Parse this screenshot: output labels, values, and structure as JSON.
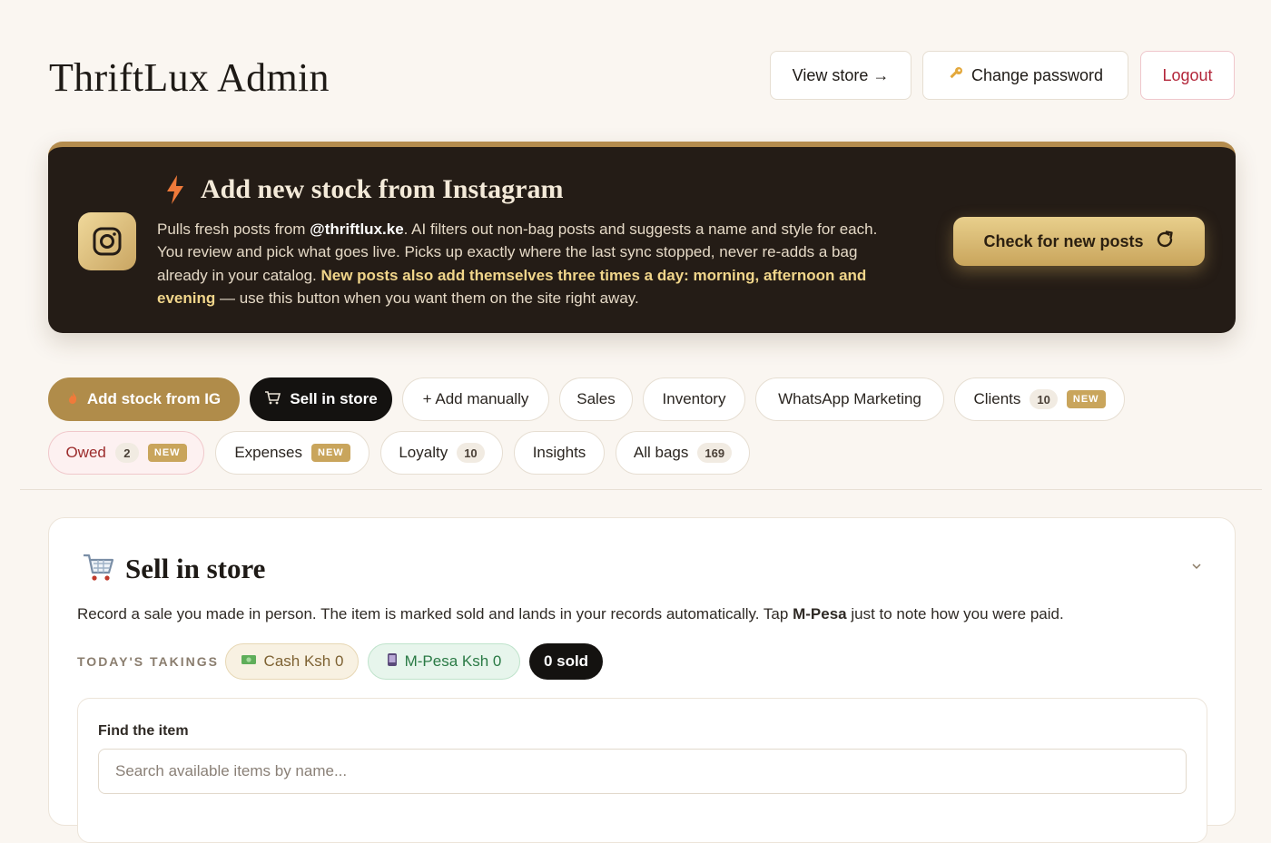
{
  "app": {
    "title": "ThriftLux Admin"
  },
  "header": {
    "view_store": "View store →",
    "change_password": "Change password",
    "logout": "Logout"
  },
  "banner": {
    "title": "Add new stock from Instagram",
    "desc_1": "Pulls fresh posts from ",
    "handle": "@thriftlux.ke",
    "desc_2": ". AI filters out non-bag posts and suggests a name and style for each. You review and pick what goes live. Picks up exactly where the last sync stopped, never re-adds a bag already in your catalog. ",
    "desc_bold": "New posts also add themselves three times a day: morning, afternoon and evening",
    "desc_3": " — use this button when you want them on the site right away.",
    "button": "Check for new posts"
  },
  "tabs": [
    {
      "label": "Add stock from IG"
    },
    {
      "label": "Sell in store"
    },
    {
      "label": "+ Add manually"
    },
    {
      "label": "Sales"
    },
    {
      "label": "Inventory"
    },
    {
      "label": "WhatsApp Marketing"
    },
    {
      "label": "Clients",
      "count": "10",
      "badge": "NEW"
    },
    {
      "label": "Owed",
      "count": "2",
      "badge": "NEW"
    },
    {
      "label": "Expenses",
      "badge": "NEW"
    },
    {
      "label": "Loyalty",
      "count": "10"
    },
    {
      "label": "Insights"
    },
    {
      "label": "All bags",
      "count": "169"
    }
  ],
  "sell": {
    "title": "Sell in store",
    "desc_1": "Record a sale you made in person. The item is marked sold and lands in your records automatically. Tap ",
    "desc_bold": "M-Pesa",
    "desc_2": " just to note how you were paid.",
    "takings_label": "TODAY'S TAKINGS",
    "cash": "Cash Ksh 0",
    "mpesa": "M-Pesa Ksh 0",
    "sold": "0 sold",
    "find_label": "Find the item",
    "search_placeholder": "Search available items by name..."
  },
  "icons": {
    "key": "key-icon",
    "bolt": "lightning-bolt-icon",
    "instagram": "instagram-icon",
    "refresh": "refresh-icon",
    "cart": "shopping-cart-icon",
    "cash": "banknote-icon",
    "phone": "mobile-phone-icon",
    "chevron": "chevron-down-icon"
  },
  "colors": {
    "background": "#faf6f1",
    "banner_bg": "#241c16",
    "gold": "#b08c4a",
    "accent_text": "#f0d58a",
    "logout": "#b3263a",
    "dark": "#141210"
  }
}
